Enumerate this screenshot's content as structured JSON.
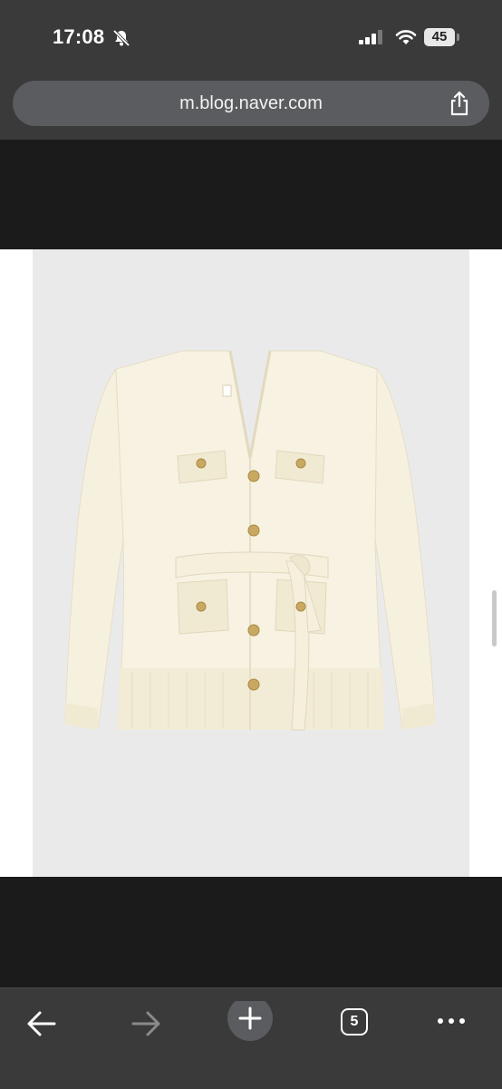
{
  "status_bar": {
    "time": "17:08",
    "battery_level": "45",
    "icons": [
      "bell-slash-icon",
      "signal-icon",
      "wifi-icon",
      "battery-icon"
    ]
  },
  "browser": {
    "url": "m.blog.naver.com",
    "share_icon": "share-icon"
  },
  "content": {
    "image_subject": "cream belted knit cardigan",
    "colors": {
      "page_dark": "#1b1b1b",
      "chrome": "#3a3a3b",
      "photo_bg": "#ebeaeb",
      "garment": "#f6f1df",
      "buttons": "#c9a862"
    }
  },
  "toolbar": {
    "tab_count": "5",
    "buttons": [
      "back-arrow-icon",
      "forward-arrow-icon",
      "plus-icon",
      "tabs-icon",
      "more-dots-icon"
    ]
  }
}
